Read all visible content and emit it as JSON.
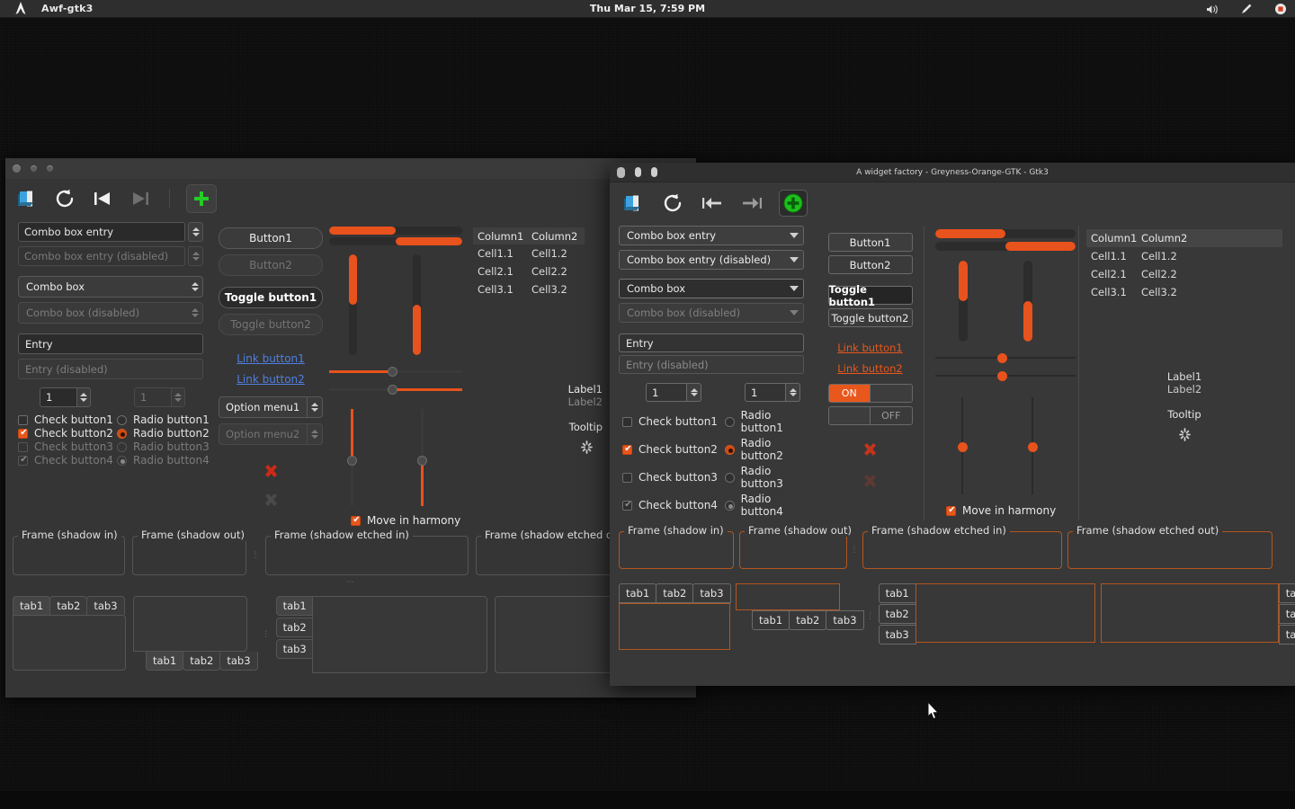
{
  "topbar": {
    "app_title": "Awf-gtk3",
    "clock": "Thu Mar 15,  7:59 PM",
    "tray": [
      {
        "name": "volume-icon",
        "glyph": "🔊"
      },
      {
        "name": "pencil-icon",
        "glyph": "✎"
      },
      {
        "name": "screen-record-icon",
        "glyph": "▣"
      }
    ]
  },
  "bg_window": {
    "title": "",
    "toolbar": {
      "open": "open-icon",
      "refresh": "refresh-icon",
      "previous": "media-previous-icon",
      "next": "media-next-icon",
      "add": "add-icon"
    },
    "combo_entry": "Combo box entry",
    "combo_entry_disabled": "Combo box entry (disabled)",
    "combo": "Combo box",
    "combo_disabled": "Combo box (disabled)",
    "entry": "Entry",
    "entry_disabled": "Entry (disabled)",
    "spin1": "1",
    "spin2": "1",
    "checks": [
      "Check button1",
      "Check button2",
      "Check button3",
      "Check button4"
    ],
    "radios": [
      "Radio button1",
      "Radio button2",
      "Radio button3",
      "Radio button4"
    ],
    "button1": "Button1",
    "button2": "Button2",
    "toggle1": "Toggle button1",
    "toggle2": "Toggle button2",
    "link1": "Link button1",
    "link2": "Link button2",
    "option1": "Option menu1",
    "option2": "Option menu2",
    "move_in_harmony": "Move in harmony",
    "tree": {
      "columns": [
        "Column1",
        "Column2"
      ],
      "rows": [
        [
          "Cell1.1",
          "Cell1.2"
        ],
        [
          "Cell2.1",
          "Cell2.2"
        ],
        [
          "Cell3.1",
          "Cell3.2"
        ]
      ]
    },
    "label1": "Label1",
    "label2": "Label2",
    "tooltip": "Tooltip",
    "frames": [
      "Frame (shadow in)",
      "Frame (shadow out)",
      "Frame (shadow etched in)",
      "Frame (shadow etched out)"
    ],
    "tabs": [
      "tab1",
      "tab2",
      "tab3"
    ]
  },
  "fg_window": {
    "title": "A widget factory - Greyness-Orange-GTK - Gtk3",
    "toolbar": {
      "open": "open-icon",
      "refresh": "refresh-icon",
      "previous": "go-first-icon",
      "next": "go-last-icon",
      "add": "add-icon"
    },
    "combo_entry": "Combo box entry",
    "combo_entry_disabled": "Combo box entry (disabled)",
    "combo": "Combo box",
    "combo_disabled": "Combo box (disabled)",
    "entry": "Entry",
    "entry_disabled": "Entry (disabled)",
    "spin1": "1",
    "spin2": "1",
    "checks": [
      "Check button1",
      "Check button2",
      "Check button3",
      "Check button4"
    ],
    "radios": [
      "Radio button1",
      "Radio button2",
      "Radio button3",
      "Radio button4"
    ],
    "button1": "Button1",
    "button2": "Button2",
    "toggle1": "Toggle button1",
    "toggle2": "Toggle button2",
    "link1": "Link button1",
    "link2": "Link button2",
    "switch_on": "ON",
    "switch_off": "OFF",
    "move_in_harmony": "Move in harmony",
    "tree": {
      "columns": [
        "Column1",
        "Column2"
      ],
      "rows": [
        [
          "Cell1.1",
          "Cell1.2"
        ],
        [
          "Cell2.1",
          "Cell2.2"
        ],
        [
          "Cell3.1",
          "Cell3.2"
        ]
      ]
    },
    "label1": "Label1",
    "label2": "Label2",
    "tooltip": "Tooltip",
    "frames": [
      "Frame (shadow in)",
      "Frame (shadow out)",
      "Frame (shadow etched in)",
      "Frame (shadow etched out)"
    ],
    "tabs": [
      "tab1",
      "tab2",
      "tab3"
    ]
  },
  "colors": {
    "accent": "#e8521c",
    "link_gtk3": "#e8571c",
    "link_gtk2": "#4f7fe0",
    "panel_bg": "#2e2e2e",
    "window_bg_gtk3": "#383838",
    "window_bg_gtk2": "#353535",
    "frame_border_gtk3": "#b3561f"
  }
}
